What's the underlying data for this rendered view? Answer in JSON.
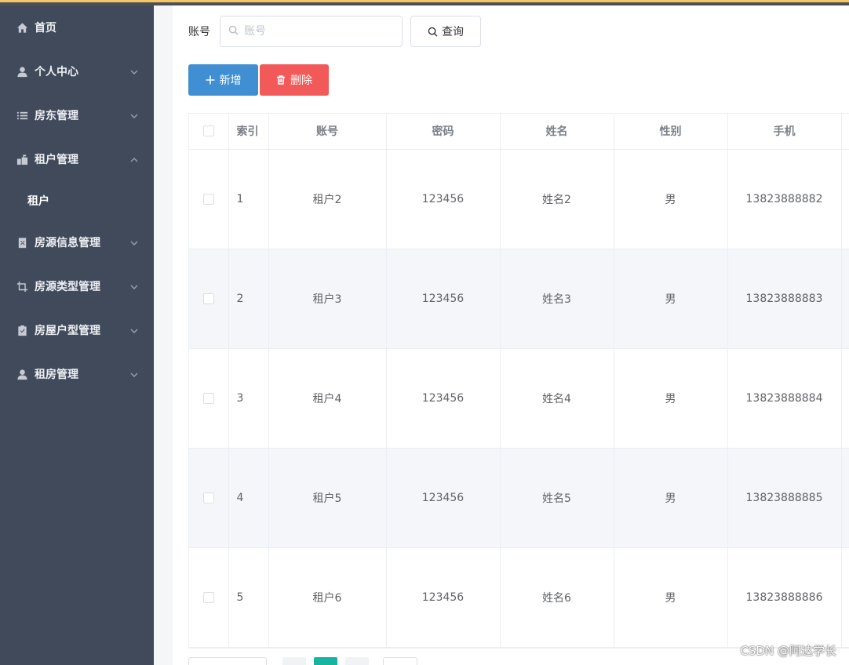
{
  "sidebar": {
    "items": [
      {
        "label": "首页",
        "icon": "home-icon",
        "has_children": false
      },
      {
        "label": "个人中心",
        "icon": "user-icon",
        "has_children": true
      },
      {
        "label": "房东管理",
        "icon": "list-icon",
        "has_children": true
      },
      {
        "label": "租户管理",
        "icon": "mailbox-icon",
        "has_children": true,
        "expanded": true,
        "children": [
          {
            "label": "租户"
          }
        ]
      },
      {
        "label": "房源信息管理",
        "icon": "delete-doc-icon",
        "has_children": true
      },
      {
        "label": "房源类型管理",
        "icon": "crop-icon",
        "has_children": true
      },
      {
        "label": "房屋户型管理",
        "icon": "clipboard-icon",
        "has_children": true
      },
      {
        "label": "租房管理",
        "icon": "user-icon",
        "has_children": true
      }
    ]
  },
  "search": {
    "label": "账号",
    "placeholder": "账号",
    "value": "",
    "button_label": "查询"
  },
  "actions": {
    "add_label": "新增",
    "delete_label": "删除"
  },
  "table": {
    "columns": [
      "索引",
      "账号",
      "密码",
      "姓名",
      "性别",
      "手机"
    ],
    "rows": [
      {
        "index": "1",
        "account": "租户2",
        "password": "123456",
        "name": "姓名2",
        "gender": "男",
        "phone": "13823888882"
      },
      {
        "index": "2",
        "account": "租户3",
        "password": "123456",
        "name": "姓名3",
        "gender": "男",
        "phone": "13823888883"
      },
      {
        "index": "3",
        "account": "租户4",
        "password": "123456",
        "name": "姓名4",
        "gender": "男",
        "phone": "13823888884"
      },
      {
        "index": "4",
        "account": "租户5",
        "password": "123456",
        "name": "姓名5",
        "gender": "男",
        "phone": "13823888885"
      },
      {
        "index": "5",
        "account": "租户6",
        "password": "123456",
        "name": "姓名6",
        "gender": "男",
        "phone": "13823888886"
      }
    ]
  },
  "watermark": "CSDN @阿达学长",
  "colors": {
    "sidebar_bg": "#414a5a",
    "primary": "#3f8fd2",
    "danger": "#f25a5a",
    "pager_current": "#17b3a3",
    "stripe": "#f5f6fa"
  }
}
